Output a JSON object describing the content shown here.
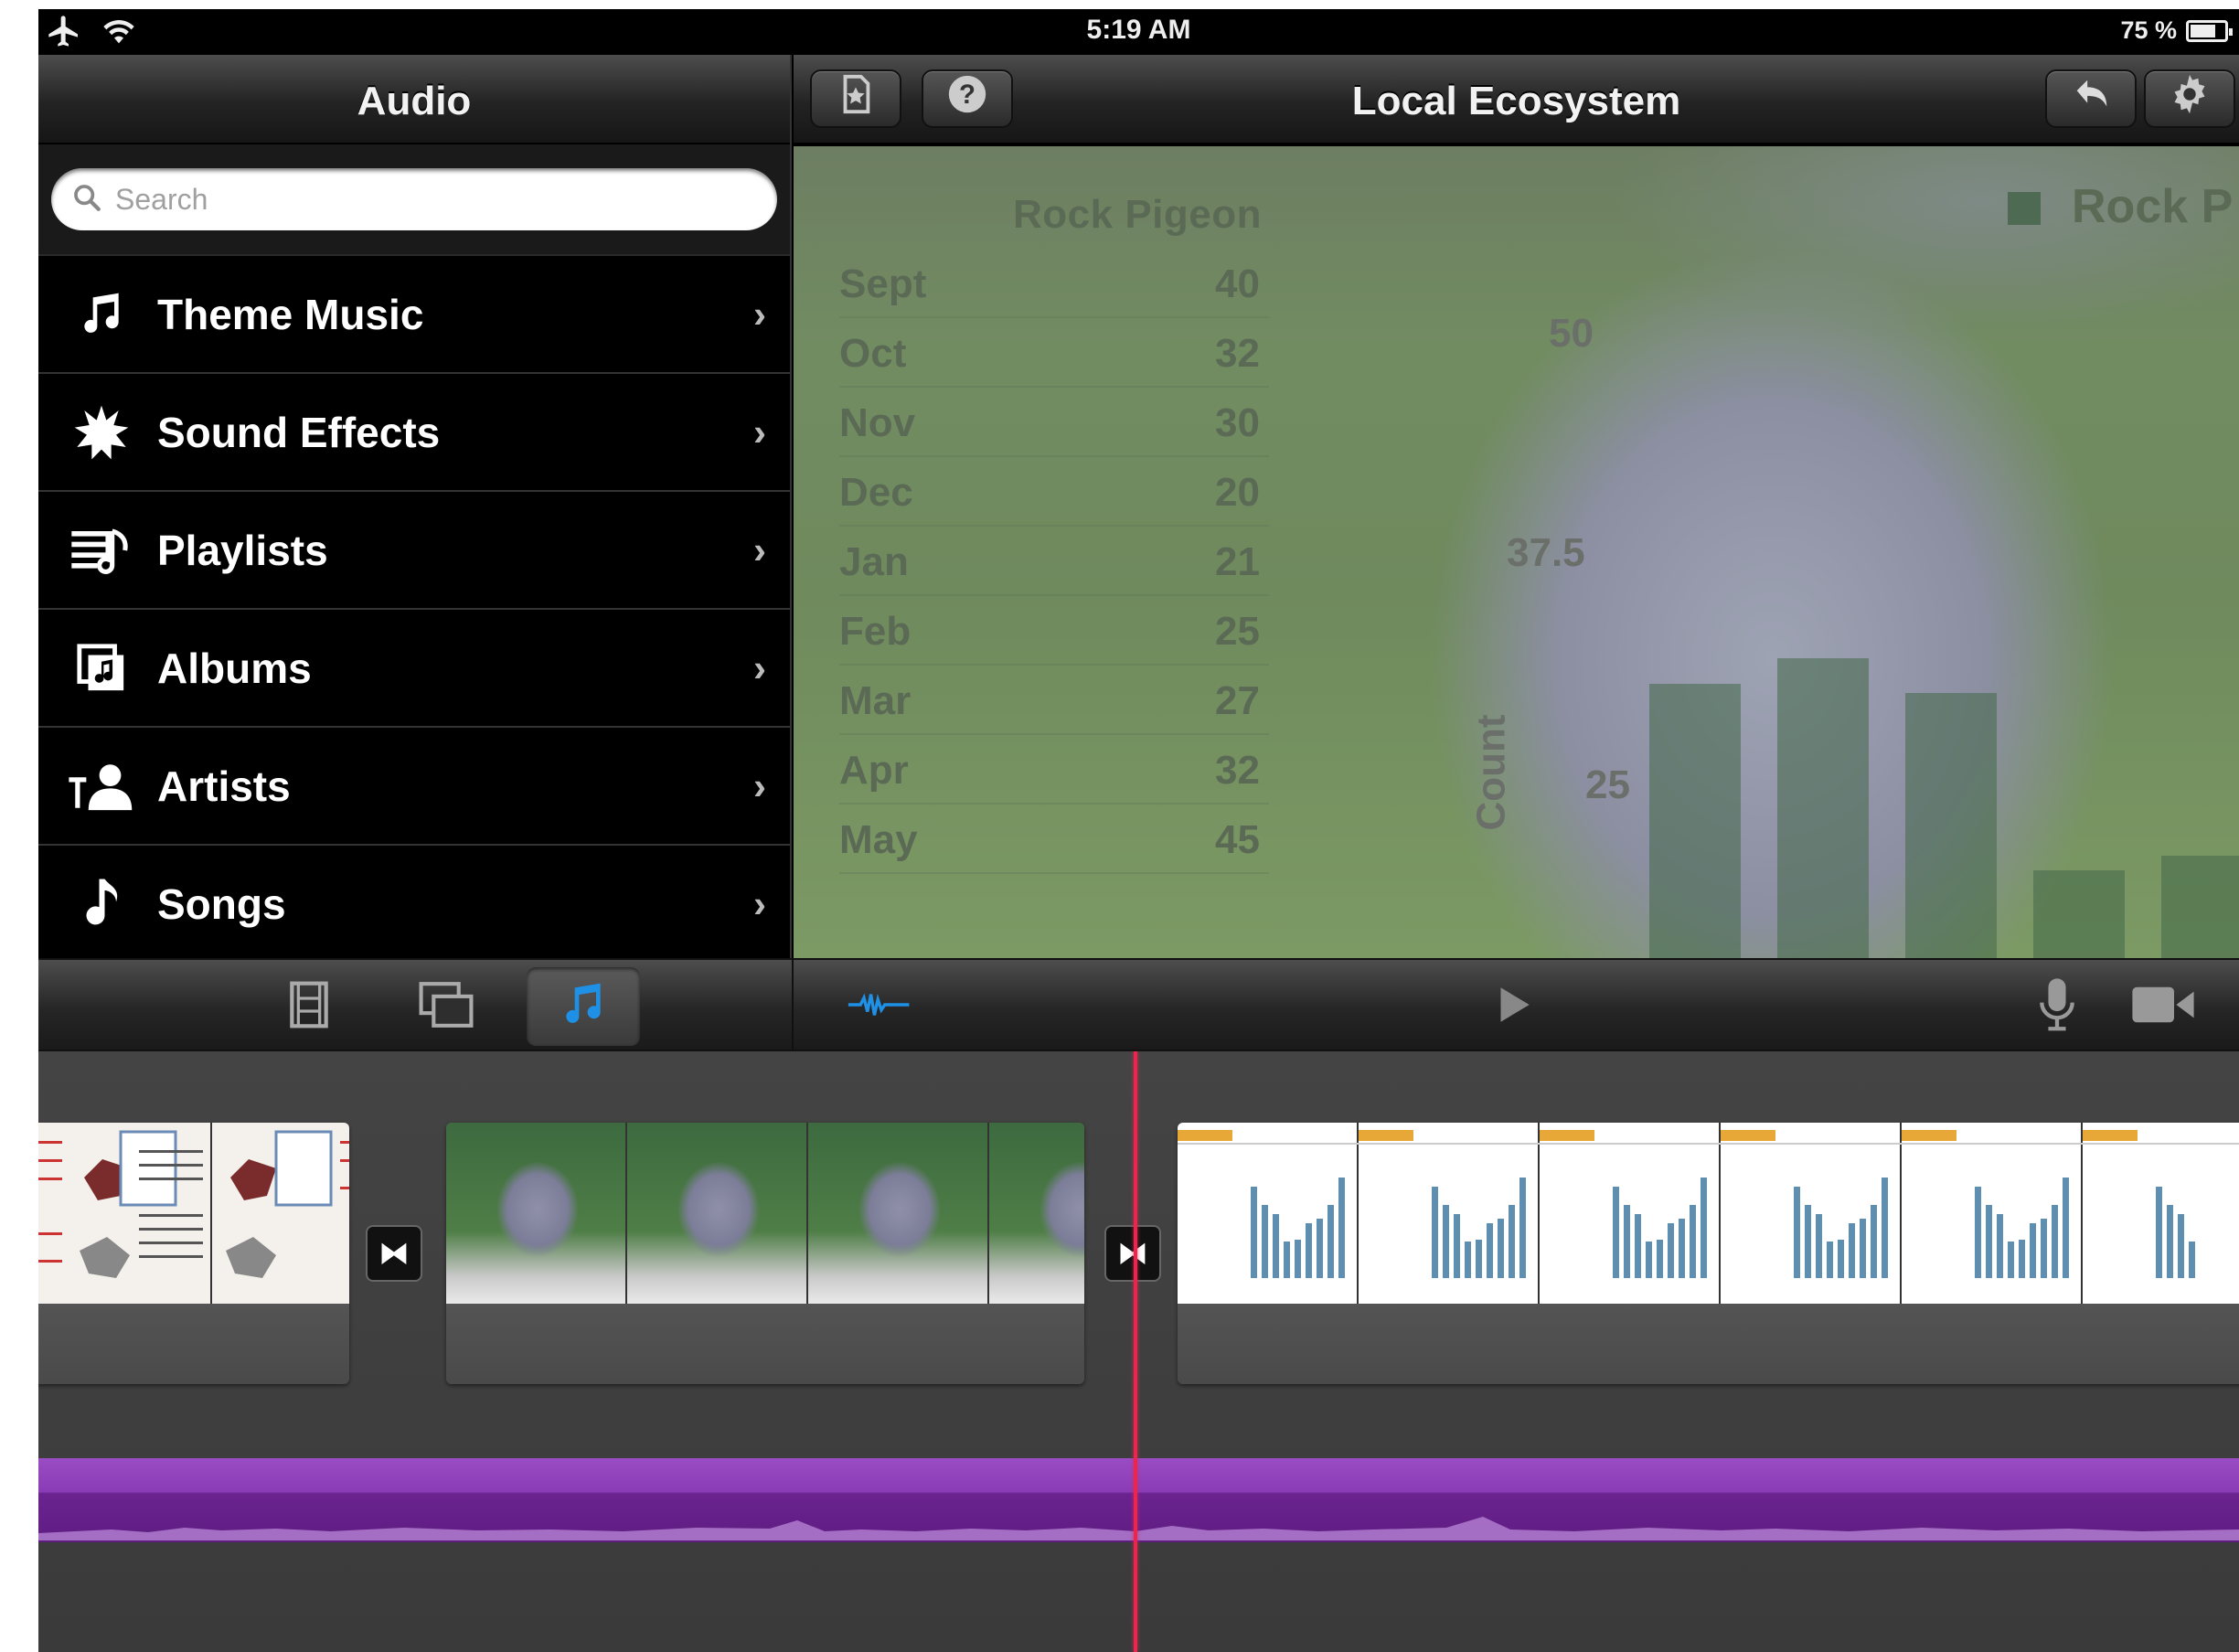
{
  "status_bar": {
    "time": "5:19 AM",
    "battery": "75 %",
    "battery_level": 0.75
  },
  "audio_panel": {
    "title": "Audio",
    "search_placeholder": "Search",
    "items": [
      {
        "label": "Theme Music",
        "icon": "music-note-icon"
      },
      {
        "label": "Sound Effects",
        "icon": "burst-icon"
      },
      {
        "label": "Playlists",
        "icon": "playlist-icon"
      },
      {
        "label": "Albums",
        "icon": "album-icon"
      },
      {
        "label": "Artists",
        "icon": "artist-icon"
      },
      {
        "label": "Songs",
        "icon": "song-icon"
      }
    ]
  },
  "viewer": {
    "title": "Local Ecosystem",
    "preview": {
      "table_header": "Rock Pigeon",
      "rows": [
        {
          "month": "Sept",
          "value": "40"
        },
        {
          "month": "Oct",
          "value": "32"
        },
        {
          "month": "Nov",
          "value": "30"
        },
        {
          "month": "Dec",
          "value": "20"
        },
        {
          "month": "Jan",
          "value": "21"
        },
        {
          "month": "Feb",
          "value": "25"
        },
        {
          "month": "Mar",
          "value": "27"
        },
        {
          "month": "Apr",
          "value": "32"
        },
        {
          "month": "May",
          "value": "45"
        }
      ],
      "axis_ticks": [
        "50",
        "37.5",
        "25"
      ],
      "axis_label": "Count",
      "legend": "Rock P"
    }
  },
  "colors": {
    "accent": "#1e90e6",
    "playhead": "#e8264f",
    "audio_track": "#8a3cb6"
  }
}
